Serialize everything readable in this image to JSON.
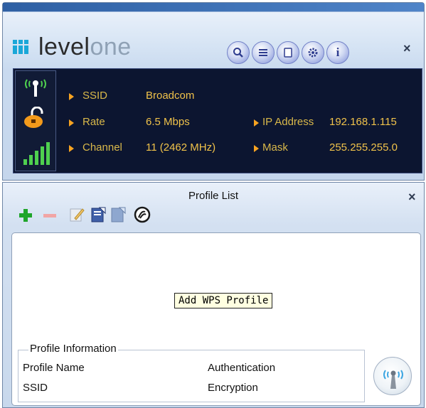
{
  "brand": {
    "name_part1": "level",
    "name_part2": "one"
  },
  "toolbar_top": {
    "buttons": [
      {
        "name": "search",
        "icon": "magnifier-icon"
      },
      {
        "name": "list",
        "icon": "list-icon"
      },
      {
        "name": "document",
        "icon": "document-icon"
      },
      {
        "name": "settings",
        "icon": "gear-icon"
      },
      {
        "name": "info",
        "icon": "info-icon"
      }
    ],
    "close": "×"
  },
  "status": {
    "ssid_label": "SSID",
    "ssid_value": "Broadcom",
    "rate_label": "Rate",
    "rate_value": "6.5 Mbps",
    "channel_label": "Channel",
    "channel_value": "11 (2462 MHz)",
    "ip_label": "IP Address",
    "ip_value": "192.168.1.115",
    "mask_label": "Mask",
    "mask_value": "255.255.255.0",
    "colors": {
      "label": "#d9b84a",
      "value": "#f0c24a",
      "bullet": "#f7a321",
      "background": "#0c1530"
    }
  },
  "profile_list": {
    "title": "Profile List",
    "close": "×",
    "tooltip": "Add WPS Profile",
    "toolbar": [
      {
        "name": "add",
        "icon": "plus-icon"
      },
      {
        "name": "remove",
        "icon": "minus-icon"
      },
      {
        "name": "edit",
        "icon": "edit-icon"
      },
      {
        "name": "import",
        "icon": "import-icon"
      },
      {
        "name": "export",
        "icon": "export-icon"
      },
      {
        "name": "wps",
        "icon": "wps-icon"
      }
    ]
  },
  "profile_info": {
    "title": "Profile Information",
    "profile_name_label": "Profile Name",
    "ssid_label": "SSID",
    "authentication_label": "Authentication",
    "encryption_label": "Encryption"
  }
}
